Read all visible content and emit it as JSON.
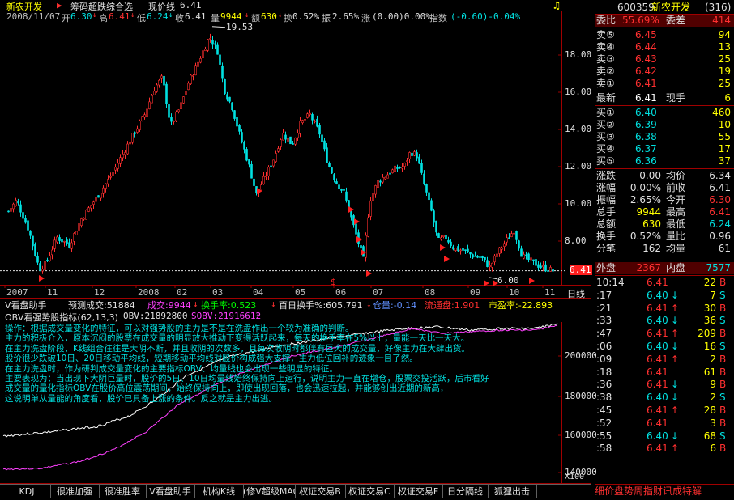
{
  "header": {
    "stock_name": "新农开发",
    "formula_title": "筹码超跌综合选",
    "current_price_label": "现价线",
    "current_price_value": "6.41"
  },
  "info": {
    "date": "2008/11/07",
    "open_label": "开",
    "open": "6.30",
    "high_label": "高",
    "high": "6.41",
    "low_label": "低",
    "low": "6.24",
    "close_label": "收",
    "close": "6.41",
    "vol_label": "量",
    "vol": "9944",
    "amount_label": "额",
    "amount": "630",
    "turnover_label": "换",
    "turnover": "0.52%",
    "amplitude_label": "振",
    "amplitude": "2.65%",
    "change_label": "涨",
    "change": "(0.00)0.00%",
    "index_label": "指数",
    "index_change": "(-0.60)-0.04%"
  },
  "price_axis": [
    "18.00",
    "16.00",
    "14.00",
    "12.00",
    "10.00",
    "8.00"
  ],
  "annotations": {
    "high_mark": "19.53",
    "low_mark": "6.00",
    "current_tag": "6.41"
  },
  "time_axis": {
    "labels": [
      "2007",
      "11",
      "12",
      "2008",
      "02",
      "03",
      "04",
      "05",
      "06",
      "07",
      "08",
      "09",
      "10",
      "11"
    ],
    "period_button": "日线"
  },
  "volume_bar": {
    "title": "V看盘助手",
    "forecast": "预测成交:51884",
    "deal": "成交:9944",
    "turnover": "换手率:0.523",
    "hundred_day": "百日换手%:605.791",
    "share": "仓量:-0.14",
    "flow": "流通盘:1.901",
    "pe": "市盈率:-22.893"
  },
  "obv": {
    "title": "OBV看强势股指标(62,13,3)",
    "obv": "OBV:21892800",
    "sobv": "SOBV:21916612",
    "axis": [
      "200000",
      "180000",
      "160000",
      "140000"
    ],
    "axis_unit": "X100"
  },
  "description": [
    "操作：根据成交量变化的特征，可以对强势股的主力是不是在洗盘作出一个较为准确的判断。",
    "主力的积极介入，原本沉闷的股票在成交量的明显放大推动下变得活跃起来，每天的换手率在5%以上，量能一天比一天大。",
    "在主力洗盘阶段，K线组合往往是大阴不断，并且收阴的次数多，且每次收阴时都伴有巨大的成交量，好像主力在大肆出货。",
    "股价很少跌破10日、20日移动平均线，短期移动平均线对股价构成强大支撑，主力低位回补的迹象一目了然。",
    "在主力洗盘时，作为研判成交量变化的主要指标OBV、均量线也会出现一些明显的特征。",
    "主要表现为：当出现下大阴巨量时，股价的5日、10日均量线始终保持向上运行，说明主力一直在增仓，股票交投活跃，后市看好",
    "成交量的量化指标OBV在股价高位震荡期间，始终保持向上，即使出现回落，也会迅速拉起，并能够创出近期的新高，",
    "这说明单从量能的角度看，股价已具备上涨的条件。反之就是主力出逃。"
  ],
  "bottom_tabs": [
    "KDJ",
    "很准加强",
    "很准胜率",
    "V看盘助手",
    "机构K线",
    "(修V超级MACD",
    "权证交易B",
    "权证交易C",
    "权证交易F",
    "日分隔线",
    "狐狸出击"
  ],
  "quote": {
    "code": "600359",
    "name": "新农开发",
    "rank": "(316)",
    "weibi_label": "委比",
    "weibi": "55.69%",
    "weicha_label": "委差",
    "weicha": "414",
    "sells": [
      {
        "label": "卖⑤",
        "price": "6.45",
        "vol": "94"
      },
      {
        "label": "卖④",
        "price": "6.44",
        "vol": "13"
      },
      {
        "label": "卖③",
        "price": "6.43",
        "vol": "25"
      },
      {
        "label": "卖②",
        "price": "6.42",
        "vol": "19"
      },
      {
        "label": "卖①",
        "price": "6.41",
        "vol": "25"
      }
    ],
    "latest_label": "最新",
    "latest": "6.41",
    "xianshou_label": "现手",
    "xianshou": "6",
    "buys": [
      {
        "label": "买①",
        "price": "6.40",
        "vol": "460"
      },
      {
        "label": "买②",
        "price": "6.39",
        "vol": "10"
      },
      {
        "label": "买③",
        "price": "6.38",
        "vol": "55"
      },
      {
        "label": "买④",
        "price": "6.37",
        "vol": "17"
      },
      {
        "label": "买⑤",
        "price": "6.36",
        "vol": "37"
      }
    ],
    "stats": [
      {
        "l1": "涨跌",
        "v1": "0.00",
        "l2": "均价",
        "v2": "6.34"
      },
      {
        "l1": "涨幅",
        "v1": "0.00%",
        "l2": "前收",
        "v2": "6.41"
      },
      {
        "l1": "振幅",
        "v1": "2.65%",
        "l2": "今开",
        "v2": "6.30"
      },
      {
        "l1": "总手",
        "v1": "9944",
        "l2": "最高",
        "v2": "6.41"
      },
      {
        "l1": "总额",
        "v1": "630",
        "l2": "最低",
        "v2": "6.24"
      },
      {
        "l1": "换手",
        "v1": "0.52%",
        "l2": "量比",
        "v2": "0.96"
      },
      {
        "l1": "分笔",
        "v1": "162",
        "l2": "均量",
        "v2": "61"
      }
    ],
    "waipan_label": "外盘",
    "waipan": "2367",
    "neipan_label": "内盘",
    "neipan": "7577"
  },
  "trades": [
    {
      "time": "10:14",
      "price": "6.41",
      "arrow": "",
      "vol": "22",
      "side": "B"
    },
    {
      "time": ":17",
      "price": "6.40",
      "arrow": "↓",
      "vol": "7",
      "side": "S"
    },
    {
      "time": ":21",
      "price": "6.41",
      "arrow": "↑",
      "vol": "30",
      "side": "B"
    },
    {
      "time": ":33",
      "price": "6.40",
      "arrow": "↓",
      "vol": "36",
      "side": "S"
    },
    {
      "time": ":47",
      "price": "6.41",
      "arrow": "↑",
      "vol": "209",
      "side": "B"
    },
    {
      "time": ":06",
      "price": "6.40",
      "arrow": "↓",
      "vol": "16",
      "side": "S"
    },
    {
      "time": ":09",
      "price": "6.41",
      "arrow": "↑",
      "vol": "2",
      "side": "B"
    },
    {
      "time": ":18",
      "price": "6.41",
      "arrow": "",
      "vol": "61",
      "side": "B"
    },
    {
      "time": ":36",
      "price": "6.41",
      "arrow": "↓",
      "vol": "9",
      "side": "B"
    },
    {
      "time": ":38",
      "price": "6.40",
      "arrow": "↓",
      "vol": "2",
      "side": "S"
    },
    {
      "time": ":45",
      "price": "6.41",
      "arrow": "↑",
      "vol": "28",
      "side": "B"
    },
    {
      "time": ":52",
      "price": "6.41",
      "arrow": "",
      "vol": "3",
      "side": "B"
    },
    {
      "time": ":55",
      "price": "6.40",
      "arrow": "↓",
      "vol": "68",
      "side": "S"
    },
    {
      "time": ":58",
      "price": "6.41",
      "arrow": "↑",
      "vol": "6",
      "side": "B"
    }
  ],
  "right_bottom_tabs": "细价盘势周指财讯成特解",
  "colors": {
    "up": "#ff3030",
    "down": "#00e0e0",
    "yellow": "#ffff00",
    "magenta": "#ff40ff",
    "green": "#00ff00",
    "grid_red": "#a00000"
  }
}
